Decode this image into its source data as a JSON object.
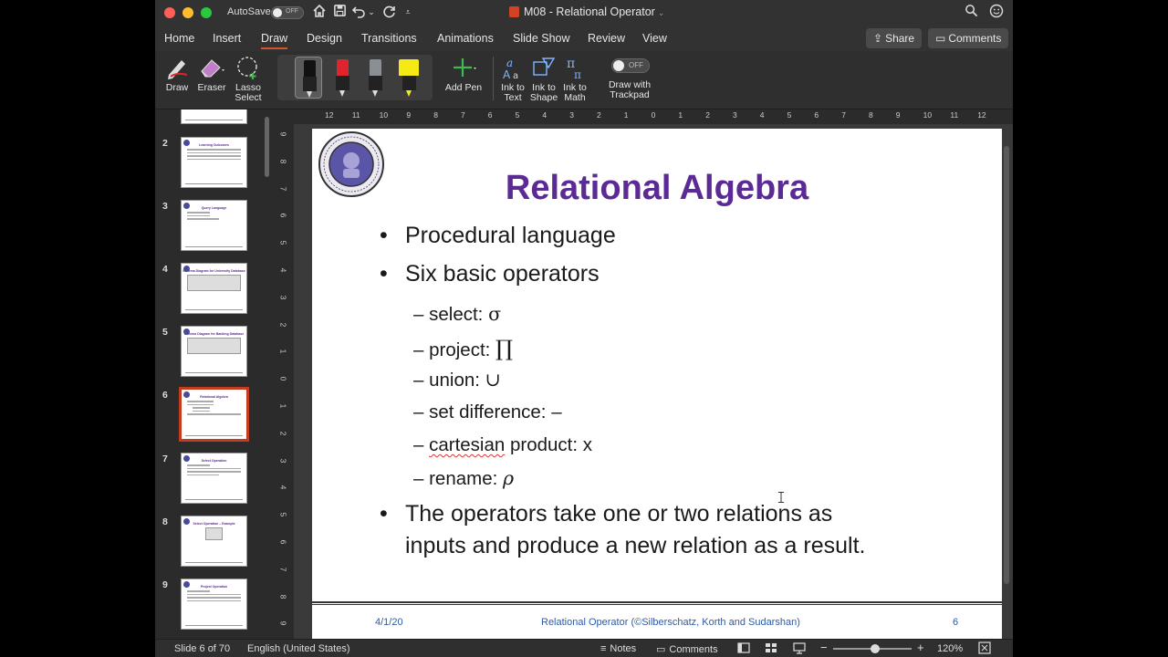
{
  "titlebar": {
    "autosave_label": "AutoSave",
    "autosave_state": "OFF",
    "document_title": "M08 - Relational Operator"
  },
  "menu": {
    "tabs": [
      "Home",
      "Insert",
      "Draw",
      "Design",
      "Transitions",
      "Animations",
      "Slide Show",
      "Review",
      "View"
    ],
    "active_tab": "Draw",
    "share_label": "Share",
    "comments_label": "Comments"
  },
  "ribbon": {
    "draw_label": "Draw",
    "eraser_label": "Eraser",
    "lasso_label_1": "Lasso",
    "lasso_label_2": "Select",
    "add_pen_label": "Add Pen",
    "ink_to_text_1": "Ink to",
    "ink_to_text_2": "Text",
    "ink_to_shape_1": "Ink to",
    "ink_to_shape_2": "Shape",
    "ink_to_math_1": "Ink to",
    "ink_to_math_2": "Math",
    "trackpad_state": "OFF",
    "trackpad_label_1": "Draw with",
    "trackpad_label_2": "Trackpad",
    "pen_colors": [
      "#111111",
      "#e0242b",
      "#8a8f96",
      "#f5ea14"
    ]
  },
  "thumbnails": [
    {
      "num": "2",
      "title": "Learning Outcomes"
    },
    {
      "num": "3",
      "title": "Query Language"
    },
    {
      "num": "4",
      "title": "Schema Diagram for University Database"
    },
    {
      "num": "5",
      "title": "Schema Diagram for Banking Database"
    },
    {
      "num": "6",
      "title": "Relational Algebra"
    },
    {
      "num": "7",
      "title": "Select Operation"
    },
    {
      "num": "8",
      "title": "Select Operation – Example"
    },
    {
      "num": "9",
      "title": "Project Operation"
    }
  ],
  "hruler_labels": [
    "12",
    "11",
    "10",
    "9",
    "8",
    "7",
    "6",
    "5",
    "4",
    "3",
    "2",
    "1",
    "0",
    "1",
    "2",
    "3",
    "4",
    "5",
    "6",
    "7",
    "8",
    "9",
    "10",
    "11",
    "12"
  ],
  "vruler_labels": [
    "9",
    "8",
    "7",
    "6",
    "5",
    "4",
    "3",
    "2",
    "1",
    "0",
    "1",
    "2",
    "3",
    "4",
    "5",
    "6",
    "7",
    "8",
    "9"
  ],
  "slide": {
    "title": "Relational Algebra",
    "bullet1": "Procedural language",
    "bullet2": "Six basic operators",
    "sub": [
      {
        "text": "select: ",
        "symbol": "σ"
      },
      {
        "text": "project: ",
        "symbol": "∏"
      },
      {
        "text": "union: ",
        "symbol": "∪"
      },
      {
        "text": "set difference: ",
        "symbol": "–"
      },
      {
        "text": "product: x",
        "symbol": ""
      },
      {
        "text": "rename: ",
        "symbol": "ρ"
      }
    ],
    "cartesian_word": "cartesian",
    "bullet3_line1": "The operators take one or two relations as",
    "bullet3_line2": "inputs and produce a new relation as a result.",
    "footer_date": "4/1/20",
    "footer_center": "Relational Operator (©Silberschatz, Korth and Sudarshan)",
    "footer_page": "6"
  },
  "status": {
    "slide_counter": "Slide 6 of 70",
    "language": "English (United States)",
    "notes_label": "Notes",
    "comments_label": "Comments",
    "zoom": "120%"
  }
}
